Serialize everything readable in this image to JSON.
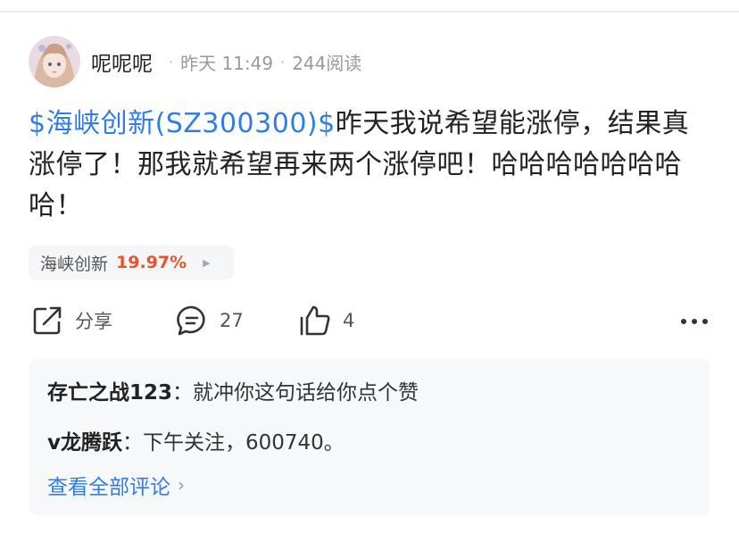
{
  "post": {
    "author": "呢呢呢",
    "time": "昨天 11:49",
    "reads": "244阅读",
    "stock_tag": "$海峡创新(SZ300300)$",
    "body": "昨天我说希望能涨停，结果真涨停了！那我就希望再来两个涨停吧！哈哈哈哈哈哈哈哈！"
  },
  "stock_chip": {
    "name": "海峡创新",
    "change": "19.97%"
  },
  "actions": {
    "share_label": "分享",
    "comment_count": "27",
    "like_count": "4"
  },
  "comments": {
    "items": [
      {
        "user": "存亡之战123",
        "sep": "：",
        "text": "就冲你这句话给你点个赞"
      },
      {
        "user": "v龙腾跃",
        "sep": "：",
        "text": "下午关注，600740。"
      }
    ],
    "view_all": "查看全部评论"
  },
  "colors": {
    "link": "#2f7ee6",
    "rise": "#e8542b",
    "meta": "#9a9a9a",
    "comment_bg": "#f7f8fa"
  },
  "icons": [
    "avatar",
    "share-icon",
    "comment-icon",
    "like-icon",
    "more-icon",
    "chevron-right-icon"
  ]
}
